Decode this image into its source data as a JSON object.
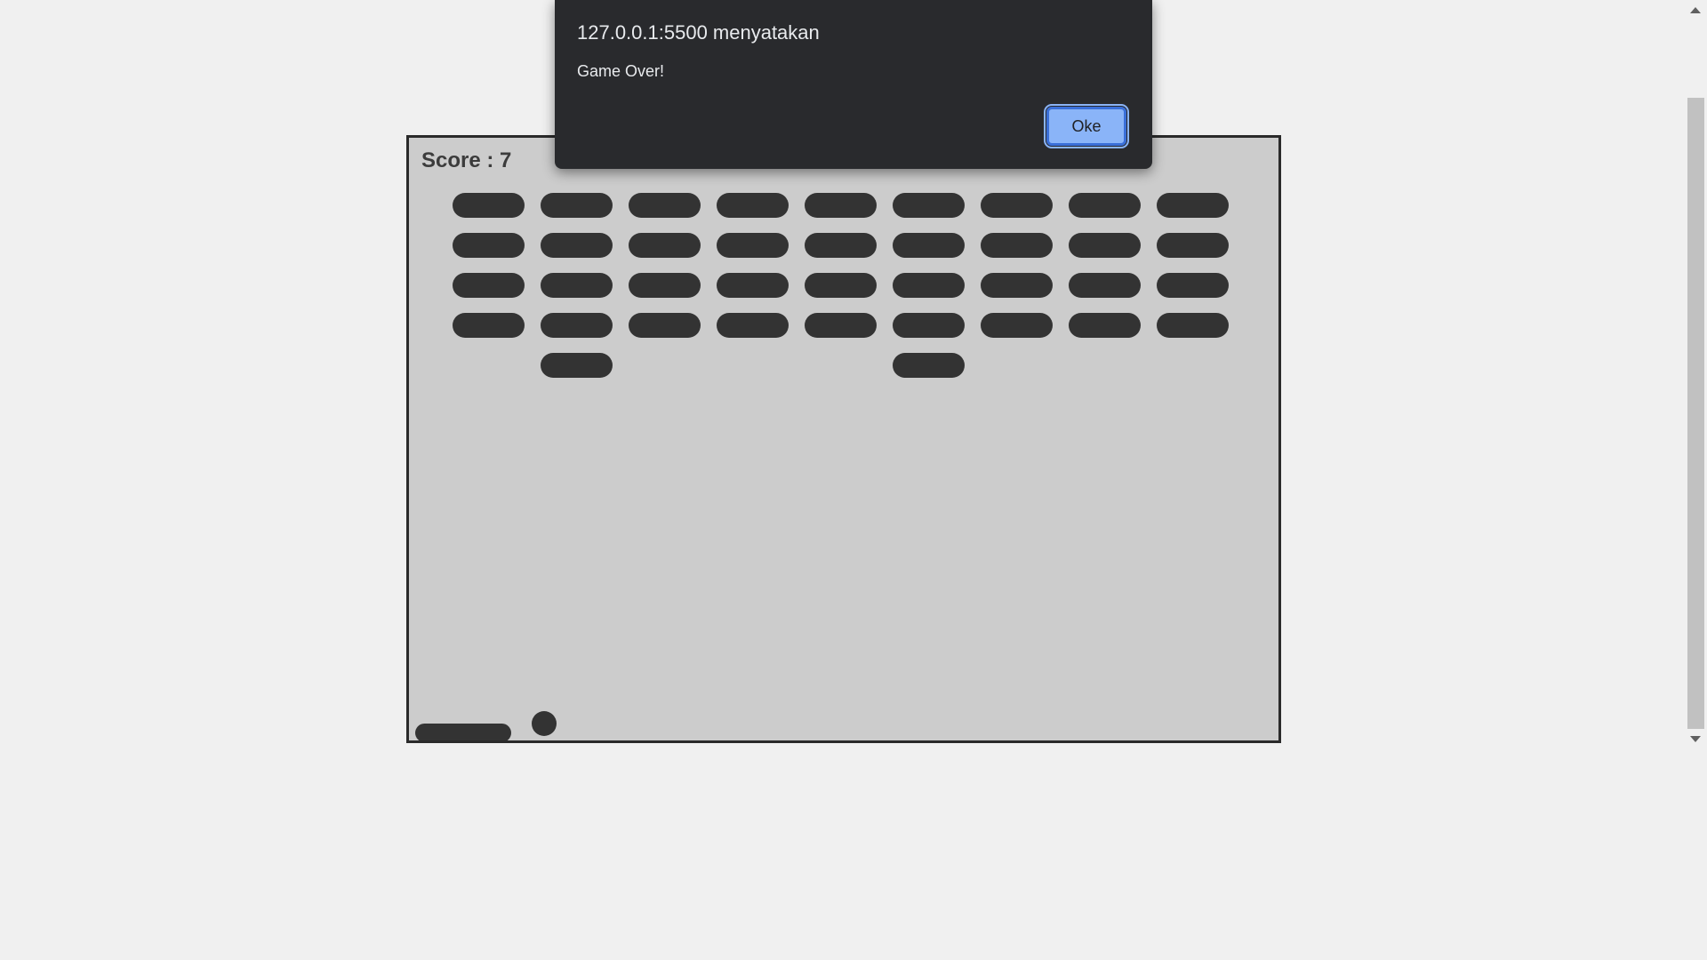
{
  "game": {
    "score_label": "Score : 7",
    "brick_color": "#333333",
    "background_color": "#cccccc",
    "bricks_remaining_by_column": [
      4,
      5,
      4,
      4,
      4,
      5,
      4,
      4,
      4
    ]
  },
  "dialog": {
    "title": "127.0.0.1:5500 menyatakan",
    "message": "Game Over!",
    "ok_label": "Oke",
    "ok_color": "#8ab4f8"
  },
  "icons": {
    "scroll_up": "scroll-up-arrow-icon",
    "scroll_down": "scroll-down-arrow-icon"
  }
}
